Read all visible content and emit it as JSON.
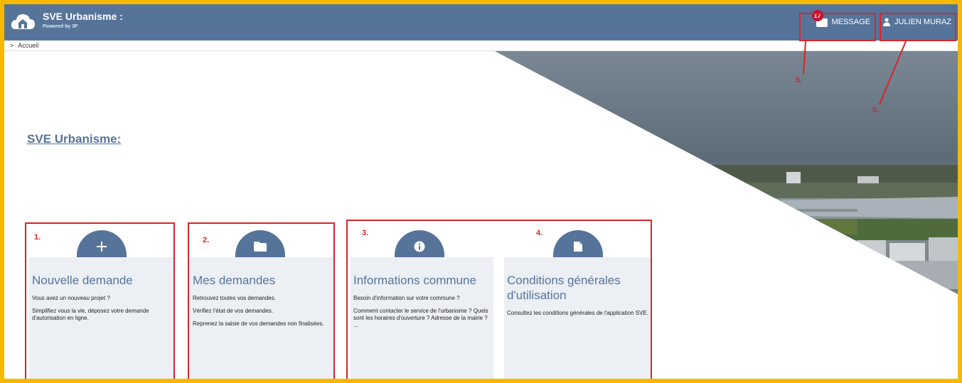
{
  "header": {
    "title": "SVE Urbanisme :",
    "powered_by": "Powered by 3F",
    "message_label": "MESSAGE",
    "message_count": "17",
    "user_label": "JULIEN MURAZ"
  },
  "breadcrumb": {
    "separator": ">",
    "item": "Accueil"
  },
  "main": {
    "page_title": "SVE Urbanisme:"
  },
  "cards": [
    {
      "number": "1.",
      "icon": "plus-icon",
      "title": "Nouvelle demande",
      "lines": [
        "Vous avez un nouveau projet ?",
        "Simplifiez vous la vie, déposez votre demande d'autorisation en ligne."
      ]
    },
    {
      "number": "2.",
      "icon": "folder-icon",
      "title": "Mes demandes",
      "lines": [
        "Retrouvez toutes vos demandes.",
        "Vérifiez l'état de vos demandes.",
        "Reprenez la saisie de vos demandes non finalisées."
      ]
    },
    {
      "number": "3.",
      "icon": "info-icon",
      "title": "Informations commune",
      "lines": [
        "Besoin d'information sur votre commune ?",
        "Comment contacter le service de l'urbanisme ? Quels sont les horaires d'ouverture ? Adresse de la mairie ? ..."
      ]
    },
    {
      "number": "4.",
      "icon": "document-icon",
      "title": "Conditions générales d'utilisation",
      "lines": [
        "Consultez les conditions générales de l'application SVE."
      ]
    }
  ],
  "annotations": {
    "five": "5.",
    "six": "6."
  },
  "colors": {
    "primary": "#56749a",
    "frame": "#f6b900",
    "annotation": "#d5262a",
    "card_bg": "#eceff4"
  }
}
